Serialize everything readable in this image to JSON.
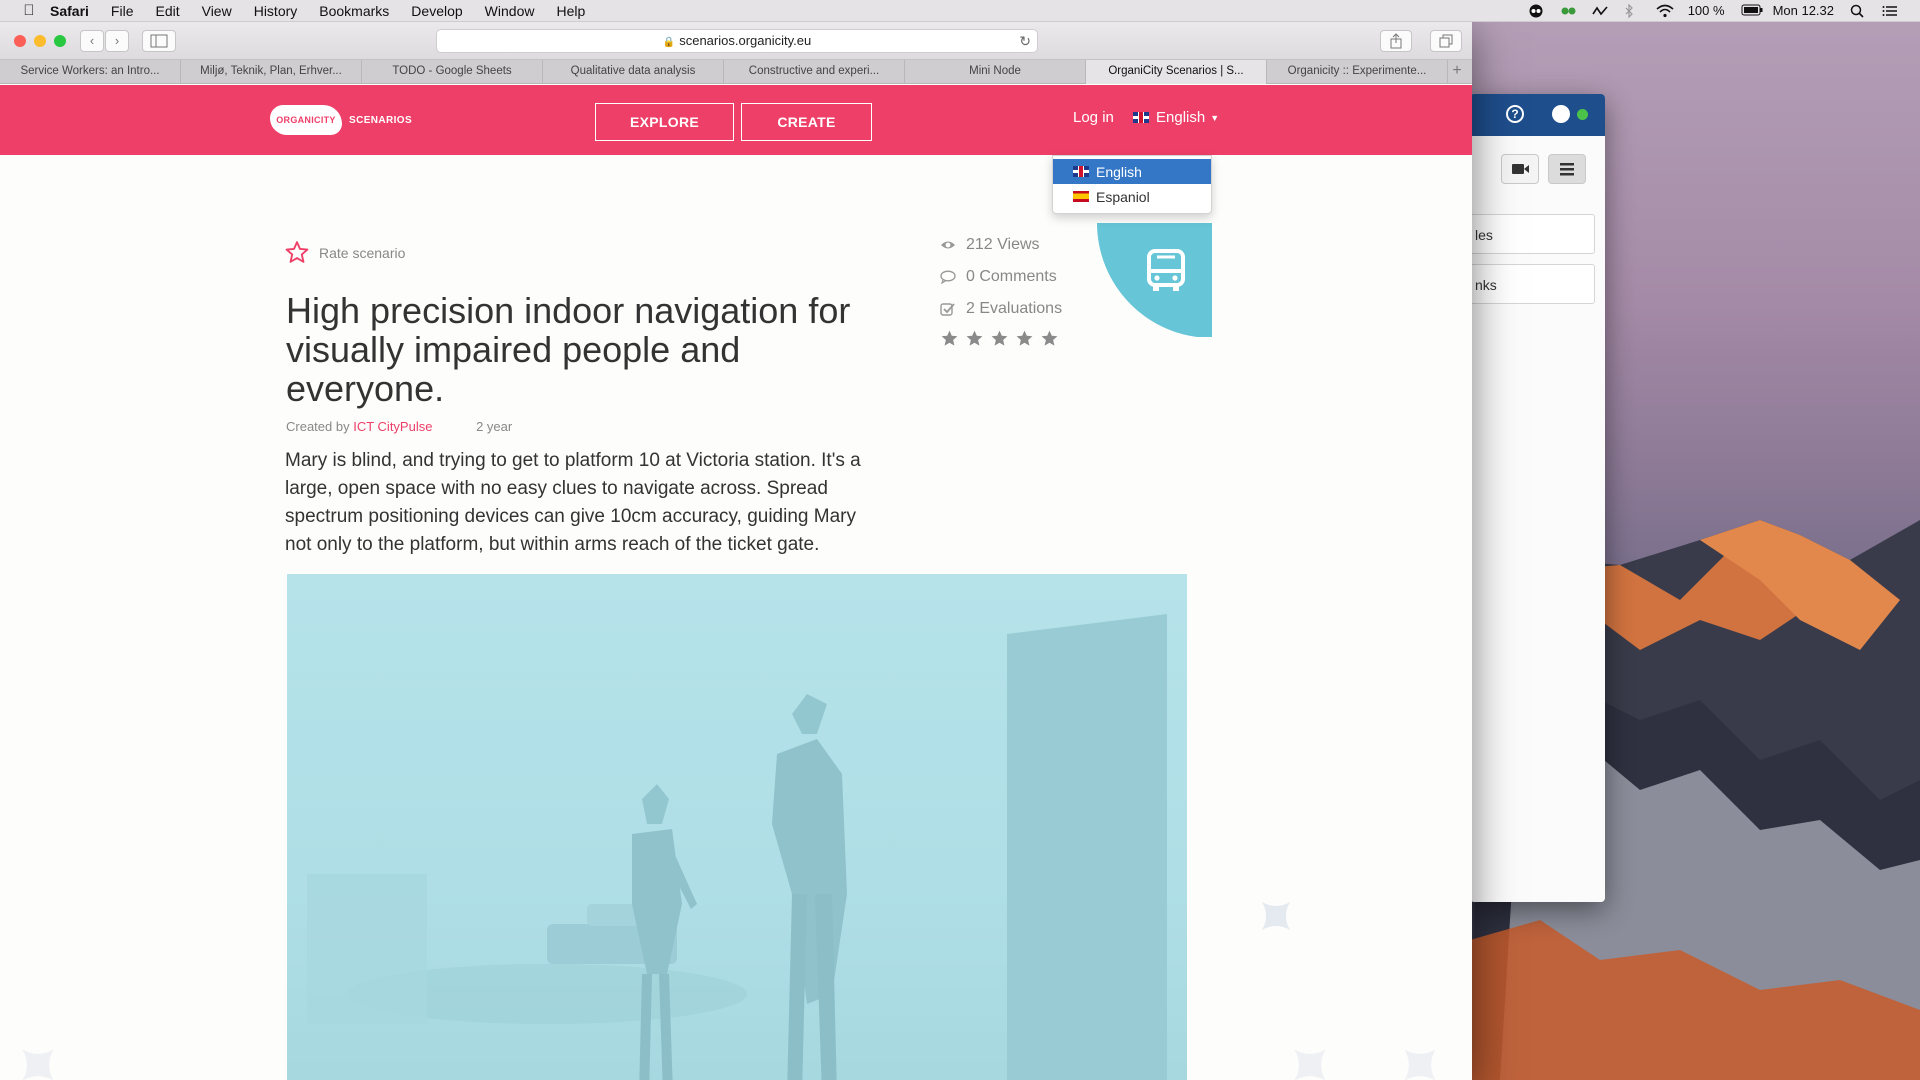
{
  "menubar": {
    "app": "Safari",
    "items": [
      "File",
      "Edit",
      "View",
      "History",
      "Bookmarks",
      "Develop",
      "Window",
      "Help"
    ],
    "battery": "100 %",
    "clock": "Mon 12.32"
  },
  "browser": {
    "url": "scenarios.organicity.eu",
    "tabs": [
      "Service Workers: an Intro...",
      "Miljø, Teknik, Plan, Erhver...",
      "TODO - Google Sheets",
      "Qualitative data analysis",
      "Constructive and experi...",
      "Mini Node",
      "OrganiCity Scenarios | S...",
      "Organicity :: Experimente..."
    ],
    "active_tab": 6
  },
  "site": {
    "logo_text": "ORGANICITY",
    "logo_sub": "SCENARIOS",
    "explore_label": "EXPLORE",
    "create_label": "CREATE",
    "login_label": "Log in",
    "language": "English",
    "languages": [
      "English",
      "Espaniol"
    ]
  },
  "scenario": {
    "rate_label": "Rate scenario",
    "title": "High precision indoor navigation for visually impaired people and everyone.",
    "created_by": "Created by",
    "author": "ICT CityPulse",
    "age": "2 year",
    "description": "Mary is blind, and trying to get to platform 10 at Victoria station. It's a large, open space with no easy clues to navigate across. Spread spectrum positioning devices can give 10cm accuracy, guiding Mary not only to the platform, but within arms reach of the ticket gate.",
    "views": "212 Views",
    "comments": "0 Comments",
    "evaluations": "2 Evaluations",
    "rating_stars": 5
  },
  "other_window": {
    "field1": "les",
    "field2": "nks"
  },
  "colors": {
    "brand": "#ee3f68",
    "badge": "#66c5d6",
    "hero": "#b6e3ea",
    "selected": "#3477c7"
  }
}
